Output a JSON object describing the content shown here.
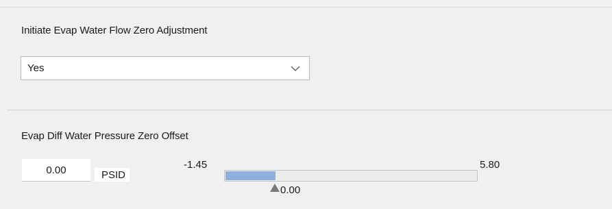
{
  "flow_zero_adjustment": {
    "label": "Initiate Evap Water Flow Zero Adjustment",
    "selected_value": "Yes",
    "dropdown_icon": "chevron-down-icon"
  },
  "pressure_zero_offset": {
    "label": "Evap Diff Water Pressure Zero Offset",
    "input_value": "0.00",
    "unit": "PSID",
    "slider": {
      "min_label": "-1.45",
      "max_label": "5.80",
      "current_label": "0.00",
      "min": -1.45,
      "max": 5.8,
      "value": 0.0,
      "fill_color": "#8db0df",
      "thumb_icon": "triangle-up-icon"
    }
  }
}
